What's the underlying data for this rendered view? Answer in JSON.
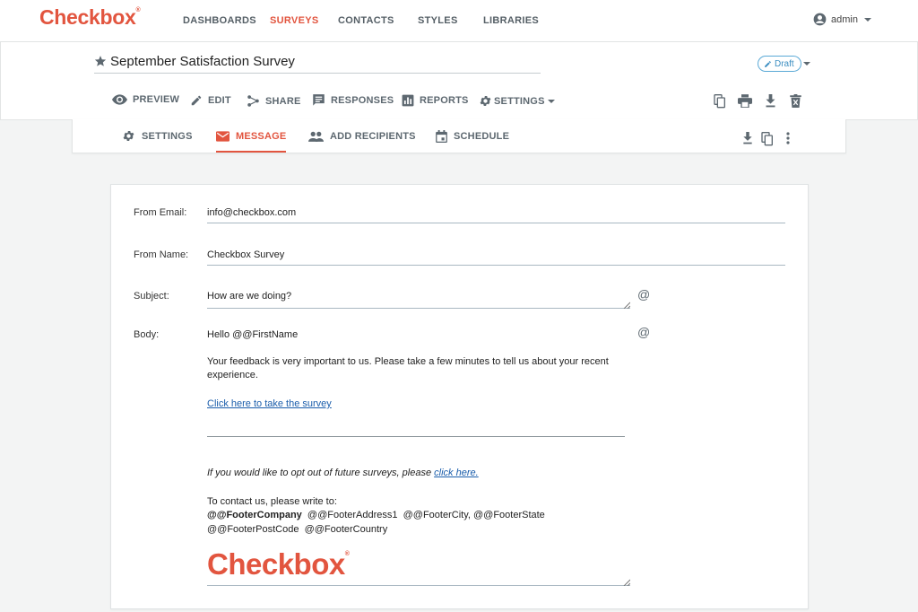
{
  "brand": {
    "logo": "Checkbox",
    "color": "#e2553f"
  },
  "topnav": {
    "links": [
      "DASHBOARDS",
      "SURVEYS",
      "CONTACTS",
      "STYLES",
      "LIBRARIES"
    ],
    "active": "SURVEYS",
    "user": "admin"
  },
  "survey": {
    "title": "September Satisfaction Survey",
    "status": "Draft"
  },
  "toolbar": {
    "preview": "PREVIEW",
    "edit": "EDIT",
    "share": "SHARE",
    "responses": "RESPONSES",
    "reports": "REPORTS",
    "settings": "SETTINGS"
  },
  "subtabs": {
    "settings": "SETTINGS",
    "message": "MESSAGE",
    "add_recipients": "ADD RECIPIENTS",
    "schedule": "SCHEDULE",
    "active": "MESSAGE"
  },
  "form": {
    "from_email_label": "From Email:",
    "from_email_value": "info@checkbox.com",
    "from_name_label": "From Name:",
    "from_name_value": "Checkbox Survey",
    "subject_label": "Subject:",
    "subject_value": "How are we doing?",
    "body_label": "Body:",
    "insert_symbol": "@",
    "body": {
      "greeting": "Hello @@FirstName",
      "paragraph_line1": "Your feedback is very important to us. Please take a few minutes to tell us about your recent",
      "paragraph_line2": "experience.",
      "survey_link": "Click here to take the survey",
      "optout_text": "If you would like to opt out of future surveys, please ",
      "optout_link": "click here.",
      "contact_intro": "To contact us, please write to:",
      "footer_company": "@@FooterCompany",
      "footer_address_line": "@@FooterAddress1  @@FooterCity, @@FooterState",
      "footer_postcode": "@@FooterPostCode",
      "footer_country": "@@FooterCountry",
      "signature_logo": "Checkbox"
    }
  }
}
